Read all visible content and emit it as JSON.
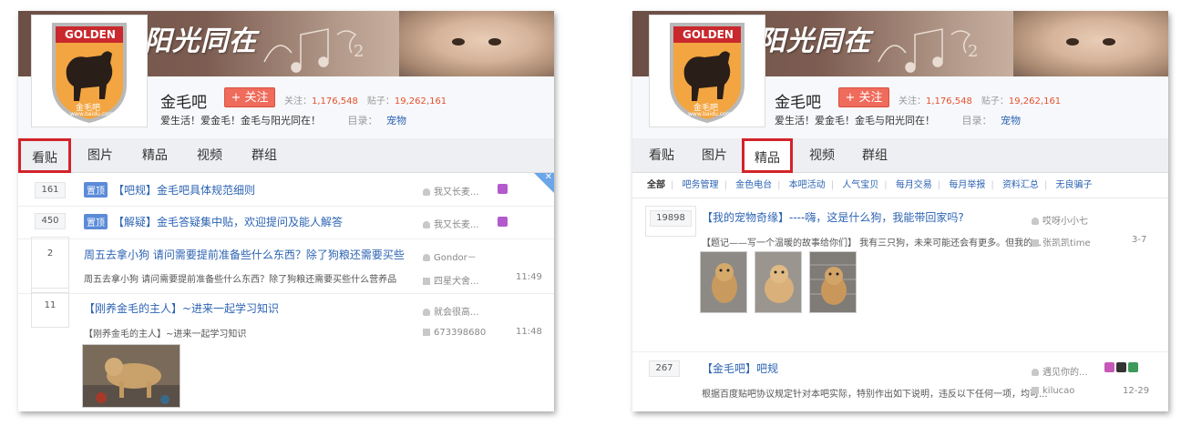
{
  "forum": {
    "logo_text": "GOLDEN",
    "logo_badge": "金毛吧",
    "logo_url": "www.baidu.com",
    "banner_title": "阳光同在",
    "name": "金毛吧",
    "follow_label": "+ 关注",
    "followers_label": "关注：",
    "followers": "1,176,548",
    "posts_label": "贴子：",
    "posts": "19,262,161",
    "slogan": "爱生活！爱金毛！金毛与阳光同在！",
    "directory_label": "目录：",
    "directory_value": "宠物"
  },
  "nav": {
    "tabs": [
      "看贴",
      "图片",
      "精品",
      "视频",
      "群组"
    ]
  },
  "left_posts": [
    {
      "count": "161",
      "badge": "置顶",
      "title": "【吧规】金毛吧具体规范细则",
      "author": "我又长麦..."
    },
    {
      "count": "450",
      "badge": "置顶",
      "title": "【解疑】金毛答疑集中贴，欢迎提问及能人解答",
      "author": "我又长麦..."
    },
    {
      "count": "2",
      "title": "周五去拿小狗 请问需要提前准备些什么东西？除了狗粮还需要买些",
      "author": "Gondor－",
      "snippet": "周五去拿小狗 请问需要提前准备些什么东西？除了狗粮还需要买些什么营养品",
      "last_reply": "四星犬舍...",
      "time": "11:49"
    },
    {
      "count": "11",
      "title": "【刚养金毛的主人】~进来一起学习知识",
      "author": "就会很高...",
      "snippet": "【刚养金毛的主人】~进来一起学习知识",
      "last_reply": "673398680",
      "time": "11:48"
    }
  ],
  "subnav": {
    "items": [
      "全部",
      "吧务管理",
      "金色电台",
      "本吧活动",
      "人气宝贝",
      "每月交易",
      "每月举报",
      "资料汇总",
      "无良骗子"
    ]
  },
  "right_posts": [
    {
      "count": "19898",
      "title": "【我的宠物奇缘】----嗨，这是什么狗，我能带回家吗?",
      "author": "哎呀小小七",
      "snippet": "【题记——写一个温暖的故事给你们】 我有三只狗，未来可能还会有更多。但我的...",
      "last_reply": "张凯凯time",
      "time": "3-7"
    },
    {
      "count": "267",
      "title": "【金毛吧】吧规",
      "author": "遇见你的...",
      "snippet": "根据百度贴吧协议规定针对本吧实际，特别作出如下说明，违反以下任何一项，均可...",
      "last_reply": "kilucao",
      "time": "12-29"
    }
  ],
  "colors": {
    "accent_red": "#d2232a",
    "link_blue": "#2d64b3",
    "follow_button": "#ef6b5c",
    "stat_number": "#e5502c",
    "top_badge": "#5b8bd8"
  }
}
